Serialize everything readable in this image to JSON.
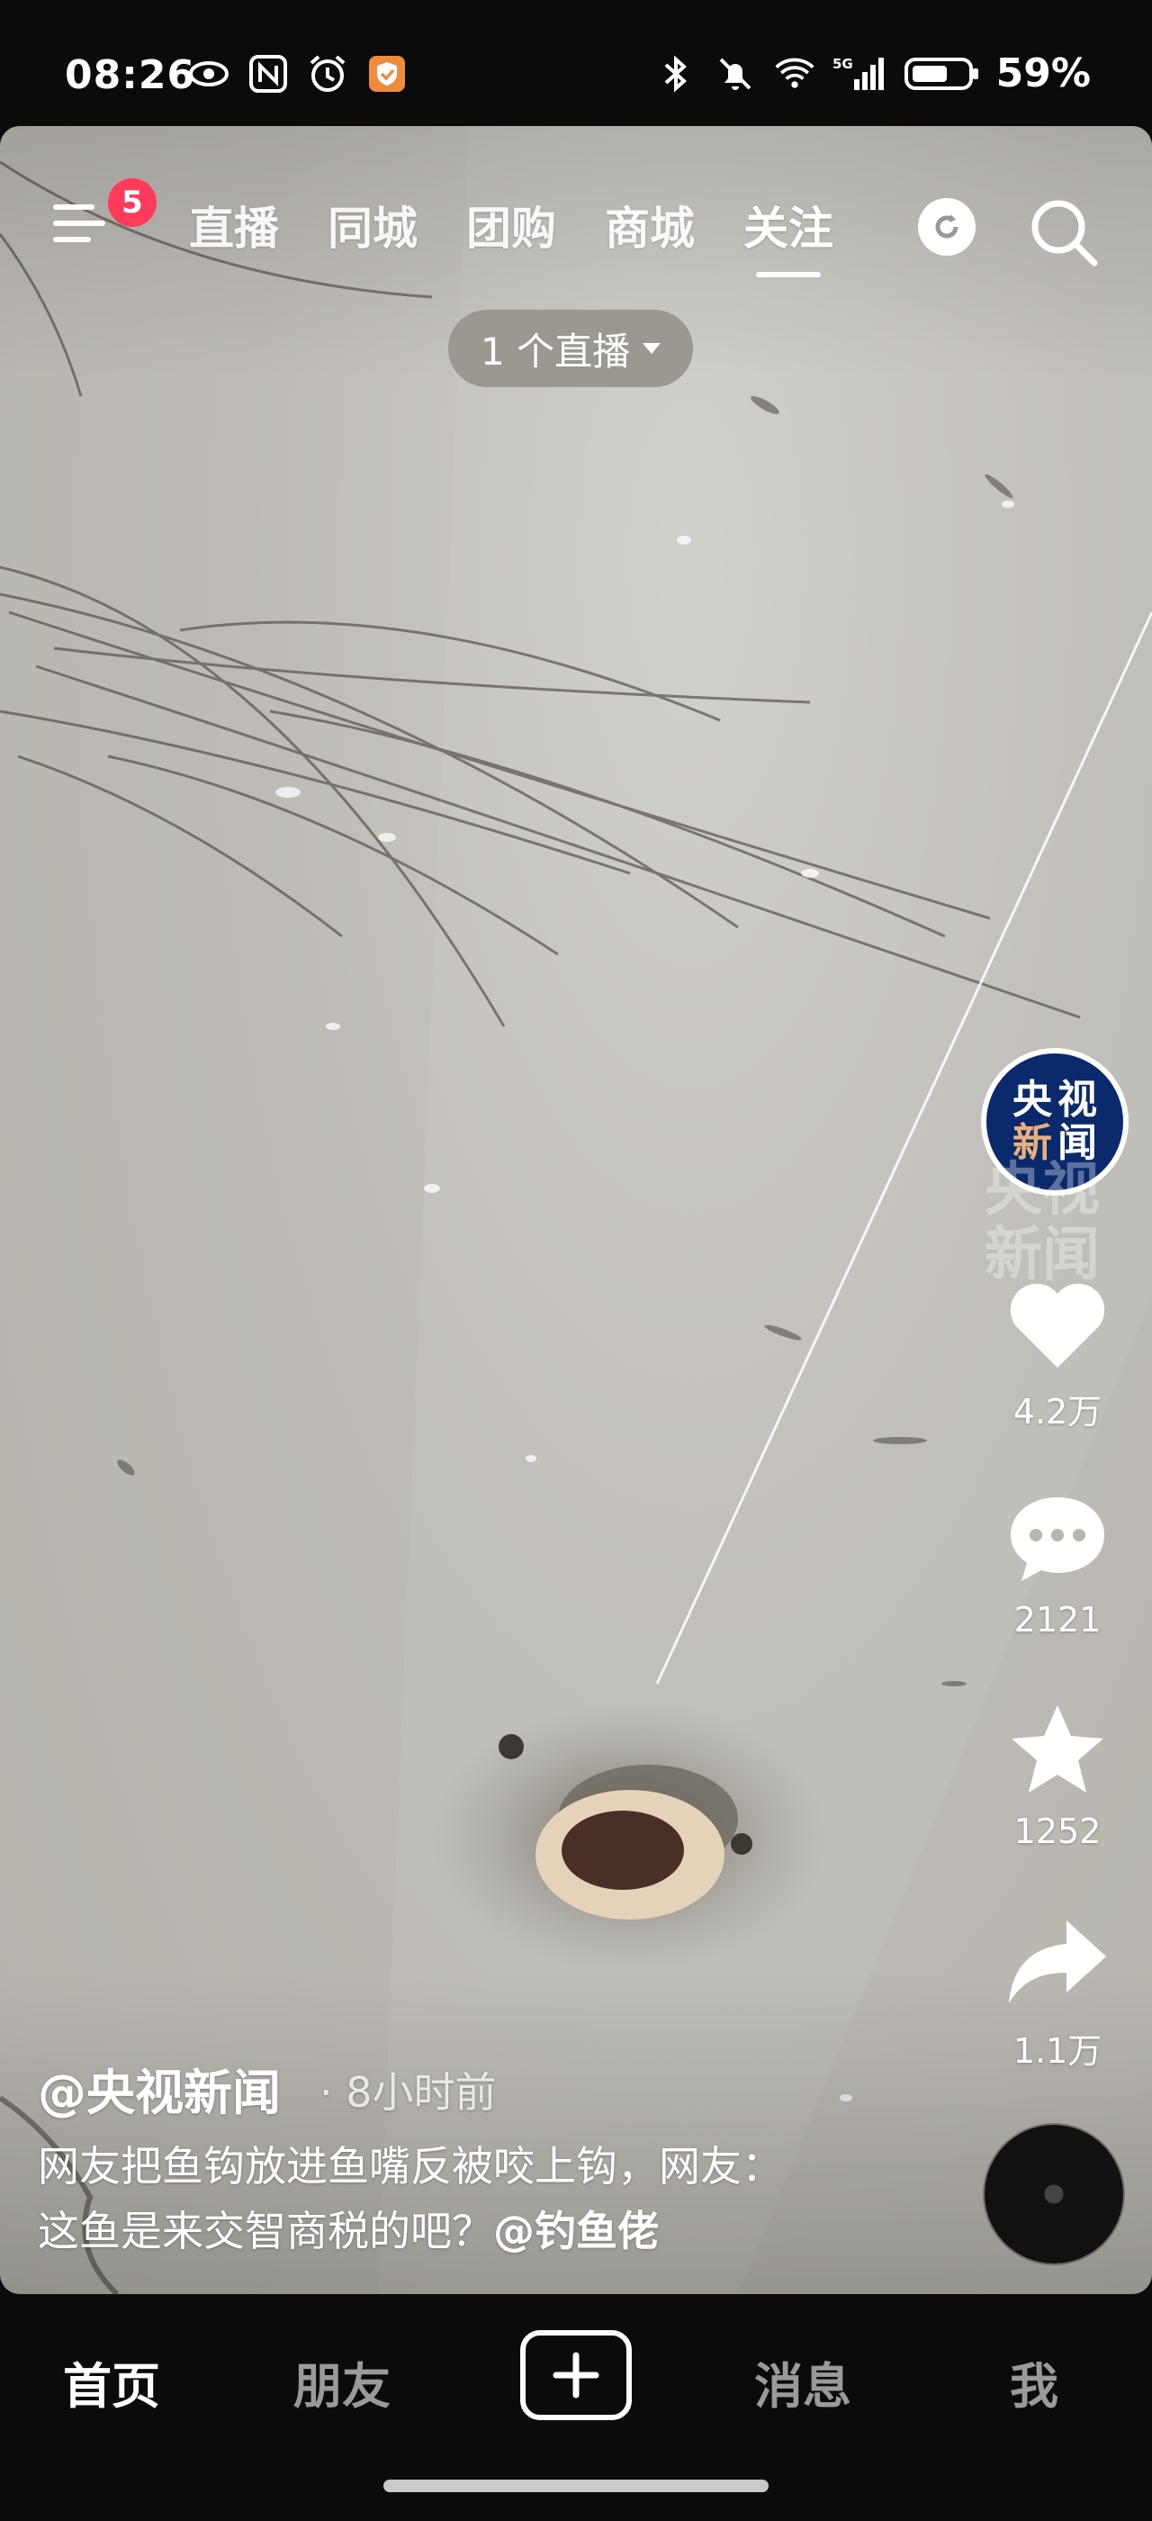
{
  "status_bar": {
    "time": "08:26",
    "battery": "59%",
    "network": "5G"
  },
  "top_nav": {
    "badge_count": "5",
    "tabs": [
      {
        "label": "直播"
      },
      {
        "label": "同城"
      },
      {
        "label": "团购"
      },
      {
        "label": "商城"
      },
      {
        "label": "关注"
      }
    ],
    "active_tab": "关注"
  },
  "live_pill": {
    "label": "1 个直播"
  },
  "right_rail": {
    "avatar_text": [
      "央",
      "视",
      "新",
      "闻"
    ],
    "watermark": [
      "央视",
      "新闻"
    ],
    "like_count": "4.2万",
    "comment_count": "2121",
    "favorite_count": "1252",
    "share_count": "1.1万"
  },
  "post": {
    "author": "@央视新闻",
    "time_ago": "· 8小时前",
    "caption_line1": "网友把鱼钩放进鱼嘴反被咬上钩，网友：",
    "caption_line2": "这鱼是来交智商税的吧？",
    "mention": "@钓鱼佬"
  },
  "bottom_nav": {
    "home": "首页",
    "friends": "朋友",
    "messages": "消息",
    "me": "我"
  },
  "colors": {
    "badge": "#ff3b5c",
    "avatar_bg": "#0b2a6e",
    "nav_bg": "#0b0b0b"
  }
}
